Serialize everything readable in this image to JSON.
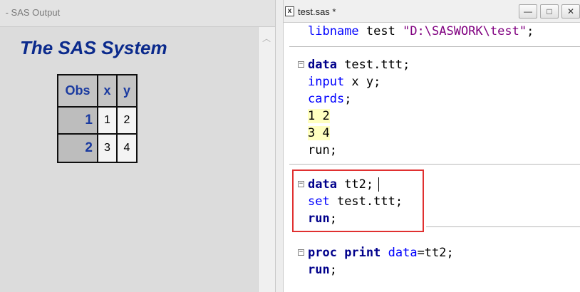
{
  "output_window": {
    "title": " - SAS Output",
    "heading": "The SAS System",
    "table": {
      "headers": [
        "Obs",
        "x",
        "y"
      ],
      "rows": [
        {
          "obs": "1",
          "x": "1",
          "y": "2"
        },
        {
          "obs": "2",
          "x": "3",
          "y": "4"
        }
      ]
    }
  },
  "editor_window": {
    "title": "test.sas *",
    "buttons": {
      "minimize": "—",
      "maximize": "□",
      "close": "✕"
    },
    "code": {
      "l1": {
        "kw": "libname",
        "rest": " test ",
        "str": "\"D:\\SASWORK\\test\"",
        "end": ";"
      },
      "l2": {
        "kw": "data",
        "rest": " test.ttt;"
      },
      "l3": {
        "kw": "input",
        "rest": " x y;"
      },
      "l4": {
        "kw": "cards",
        "rest": ";"
      },
      "l5": "1 2",
      "l6": "3 4",
      "l7": "run;",
      "l8": {
        "kw": "data",
        "rest": " tt2;"
      },
      "l9": {
        "kw": "set",
        "rest": " test.ttt;"
      },
      "l10": {
        "kw": "run",
        "rest": ";"
      },
      "l11": {
        "kw1": "proc",
        "kw2": " print",
        "kw3": " data",
        "rest": "=tt2;"
      },
      "l12": {
        "kw": "run",
        "rest": ";"
      }
    }
  },
  "colors": {
    "keyword_bold": "#00008b",
    "keyword": "#0000ff",
    "string": "#800080",
    "datalines_bg": "#ffffc0",
    "highlight_box": "#e03030",
    "output_heading": "#0b2a8c"
  },
  "icons": [
    "file-icon",
    "minimize-icon",
    "maximize-icon",
    "close-icon",
    "fold-minus-icon",
    "scroll-up-icon"
  ]
}
